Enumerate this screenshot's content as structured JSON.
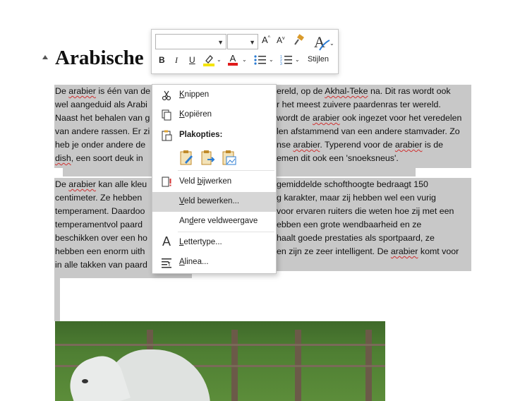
{
  "document": {
    "heading": "Arabische",
    "paragraph1": [
      [
        {
          "t": "De "
        },
        {
          "t": "arabier",
          "sq": true
        },
        {
          "t": " is één van de"
        }
      ],
      [
        {
          "t": "wel aangeduid als Arabi"
        }
      ],
      [
        {
          "t": "Naast het behalen van g"
        }
      ],
      [
        {
          "t": "van andere rassen. Er zi"
        }
      ],
      [
        {
          "t": "heb je onder andere de"
        }
      ],
      [
        {
          "t": "dish",
          "sq": true
        },
        {
          "t": ", een soort deuk in"
        }
      ]
    ],
    "paragraph1_right": [
      [
        {
          "t": "ereld, op de "
        },
        {
          "t": "Akhal-Teke",
          "sq": true
        },
        {
          "t": " na. Dit ras wordt ook"
        }
      ],
      [
        {
          "t": "r het meest zuivere paardenras ter wereld."
        }
      ],
      [
        {
          "t": "wordt de "
        },
        {
          "t": "arabier",
          "sq": true
        },
        {
          "t": " ook ingezet voor het veredelen"
        }
      ],
      [
        {
          "t": "len afstammend van een andere stamvader. Zo"
        }
      ],
      [
        {
          "t": "nse "
        },
        {
          "t": "arabier",
          "sq": true
        },
        {
          "t": ". Typerend voor de "
        },
        {
          "t": "arabier",
          "sq": true
        },
        {
          "t": " is de"
        }
      ],
      [
        {
          "t": "emen dit ook een 'snoeksneus'."
        }
      ]
    ],
    "paragraph2": [
      [
        {
          "t": "De "
        },
        {
          "t": "arabier",
          "sq": true
        },
        {
          "t": " kan alle kleu"
        }
      ],
      [
        {
          "t": "centimeter. Ze hebben"
        }
      ],
      [
        {
          "t": "temperament. Daardoo"
        }
      ],
      [
        {
          "t": "temperamentvol paard"
        }
      ],
      [
        {
          "t": "beschikken over een ho"
        }
      ],
      [
        {
          "t": "hebben een enorm uith"
        }
      ],
      [
        {
          "t": "in alle takken van paard"
        }
      ]
    ],
    "paragraph2_right": [
      [
        {
          "t": "gemiddelde schofthoogte bedraagt 150"
        }
      ],
      [
        {
          "t": "g karakter, maar zij hebben wel een vurig"
        }
      ],
      [
        {
          "t": "voor ervaren ruiters die weten hoe zij met een"
        }
      ],
      [
        {
          "t": "ebben een grote wendbaarheid en ze"
        }
      ],
      [
        {
          "t": "haalt goede prestaties als sportpaard, ze"
        }
      ],
      [
        {
          "t": "en zijn ze zeer intelligent. De "
        },
        {
          "t": "arabier",
          "sq": true
        },
        {
          "t": " komt voor"
        }
      ],
      [
        {
          "t": ""
        }
      ]
    ]
  },
  "mini_toolbar": {
    "font_name": "",
    "font_size": "",
    "grow_font": "A",
    "shrink_font": "A",
    "bold": "B",
    "italic": "I",
    "underline": "U",
    "font_color": "A",
    "styles_label": "Stijlen",
    "highlight_color": "#f5e400",
    "font_color_value": "#e01b1b"
  },
  "context_menu": {
    "items": [
      {
        "label_pre": "",
        "accel": "K",
        "label_post": "nippen",
        "icon": "scissors-icon"
      },
      {
        "label_pre": "",
        "accel": "K",
        "label_post": "opiëren",
        "icon": "copy-icon"
      },
      {
        "label": "Plakopties:",
        "icon": "clipboard-icon",
        "bold": true
      },
      {
        "label_pre": "Veld ",
        "accel": "b",
        "label_post": "ijwerken",
        "icon": "update-field-icon"
      },
      {
        "label_pre": "",
        "accel": "V",
        "label_post": "eld bewerken...",
        "icon": "",
        "hover": true
      },
      {
        "label_pre": "An",
        "accel": "d",
        "label_post": "ere veldweergave",
        "icon": ""
      },
      {
        "label_pre": "",
        "accel": "L",
        "label_post": "ettertype...",
        "icon": "font-icon"
      },
      {
        "label_pre": "",
        "accel": "A",
        "label_post": "linea...",
        "icon": "paragraph-icon"
      }
    ],
    "paste_options": [
      "paste-keep-formatting-icon",
      "paste-merge-formatting-icon",
      "paste-picture-icon"
    ]
  }
}
